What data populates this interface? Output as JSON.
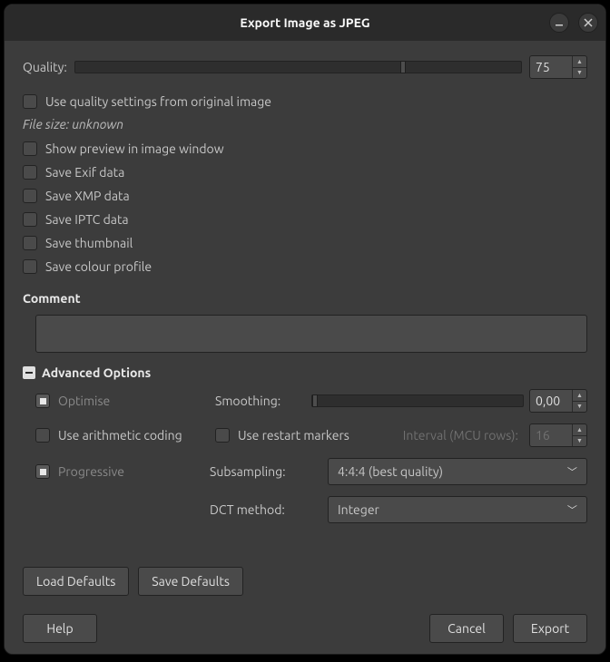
{
  "title": "Export Image as JPEG",
  "quality": {
    "label": "Quality:",
    "value": "75",
    "percent": 75
  },
  "use_quality_orig": "Use quality settings from original image",
  "filesize": "File size: unknown",
  "checks": {
    "preview": "Show preview in image window",
    "exif": "Save Exif data",
    "xmp": "Save XMP data",
    "iptc": "Save IPTC data",
    "thumb": "Save thumbnail",
    "colour": "Save colour profile"
  },
  "comment_label": "Comment",
  "advanced": {
    "title": "Advanced Options",
    "optimise": "Optimise",
    "smoothing_label": "Smoothing:",
    "smoothing_value": "0,00",
    "arith": "Use arithmetic coding",
    "restart": "Use restart markers",
    "interval_label": "Interval (MCU rows):",
    "interval_value": "16",
    "progressive": "Progressive",
    "subsampling_label": "Subsampling:",
    "subsampling_value": "4:4:4 (best quality)",
    "dct_label": "DCT method:",
    "dct_value": "Integer"
  },
  "buttons": {
    "load_defaults": "Load Defaults",
    "save_defaults": "Save Defaults",
    "help": "Help",
    "cancel": "Cancel",
    "export": "Export"
  }
}
